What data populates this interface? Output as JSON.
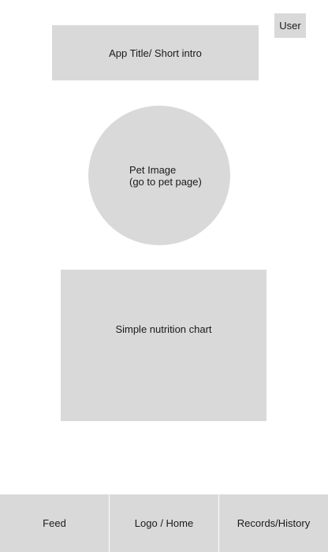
{
  "header": {
    "user_label": "User",
    "title_text": "App Title/ Short intro"
  },
  "pet": {
    "line1": "Pet Image",
    "line2": "(go to pet page)"
  },
  "nutrition": {
    "label": "Simple nutrition chart"
  },
  "bottom_nav": {
    "items": [
      {
        "label": "Feed"
      },
      {
        "label": "Logo / Home"
      },
      {
        "label": "Records/History"
      }
    ]
  },
  "colors": {
    "placeholder": "#d9d9d9",
    "background": "#ffffff",
    "text": "#1a1a1a"
  }
}
